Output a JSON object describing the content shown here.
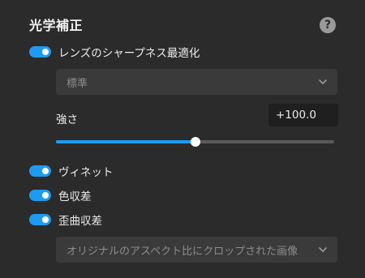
{
  "panel": {
    "title": "光学補正",
    "help_icon": "?"
  },
  "lens_sharpness": {
    "enabled": true,
    "label": "レンズのシャープネス最適化",
    "preset_value": "標準",
    "strength_label": "強さ",
    "strength_value": "+100.0",
    "strength_fraction": 0.5
  },
  "vignette": {
    "enabled": true,
    "label": "ヴィネット"
  },
  "chromatic_aberration": {
    "enabled": true,
    "label": "色収差"
  },
  "distortion": {
    "enabled": true,
    "label": "歪曲収差",
    "mode_value": "オリジナルのアスペクト比にクロップされた画像"
  },
  "colors": {
    "accent": "#1e9bf0",
    "background": "#2b2b2b"
  }
}
